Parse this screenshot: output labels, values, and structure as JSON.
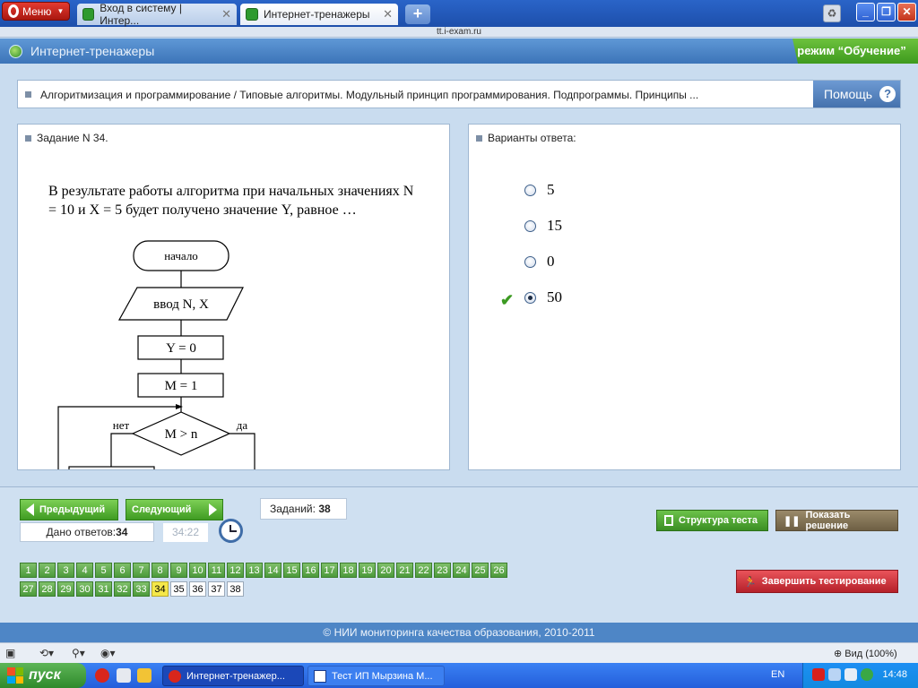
{
  "browser": {
    "menu_label": "Меню",
    "tabs": [
      {
        "label": "Вход в систему | Интер..."
      },
      {
        "label": "Интернет-тренажеры"
      }
    ],
    "new_tab_symbol": "+",
    "window_buttons": {
      "minimize": "_",
      "maximize": "❐",
      "close": "✕"
    },
    "url": "tt.i-exam.ru"
  },
  "header": {
    "site_title": "Интернет-тренажеры",
    "mode": "режим “Обучение”"
  },
  "breadcrumb": "Алгоритмизация и программирование / Типовые алгоритмы. Модульный принцип программирования. Подпрограммы. Принципы ...",
  "help": {
    "label": "Помощь",
    "icon": "?"
  },
  "task": {
    "heading": "Задание N 34.",
    "question": "В результате работы алгоритма при начальных значениях N = 10 и X = 5 будет получено значение Y, равное …",
    "flowchart": {
      "start": "начало",
      "input": "ввод  N, X",
      "step1": "Y = 0",
      "step2": "M = 1",
      "condition": "M > n",
      "no_label": "нет",
      "yes_label": "да"
    }
  },
  "answers": {
    "heading": "Варианты ответа:",
    "options": [
      {
        "label": "5",
        "selected": false
      },
      {
        "label": "15",
        "selected": false
      },
      {
        "label": "0",
        "selected": false
      },
      {
        "label": "50",
        "selected": true
      }
    ],
    "correct_index": 3
  },
  "navigation": {
    "prev_label": "Предыдущий",
    "next_label": "Следующий",
    "tasks_count_label": "Заданий:",
    "tasks_count": "38",
    "answers_given_label": "Дано ответов:",
    "answers_given": "34",
    "timer": "34:22",
    "structure_label": "Структура теста",
    "solution_label": "Показать решение",
    "finish_label": "Завершить тестирование",
    "current_task": 34,
    "answered_tasks": 33,
    "total_tasks": 38
  },
  "footer": "© НИИ мониторинга качества образования, 2010-2011",
  "statusbar": {
    "zoom": "Вид (100%)"
  },
  "taskbar": {
    "start_label": "пуск",
    "tasks": [
      {
        "label": "Интернет-тренажер..."
      },
      {
        "label": "Тест ИП Мырзина М..."
      }
    ],
    "language": "EN",
    "time": "14:48"
  },
  "colors": {
    "accent_blue": "#4e86c6",
    "mode_green": "#3e9a1e",
    "task_cell_green": "#4c9a3b",
    "current_task_yellow": "#f5e84a",
    "finish_red": "#b5212a"
  }
}
